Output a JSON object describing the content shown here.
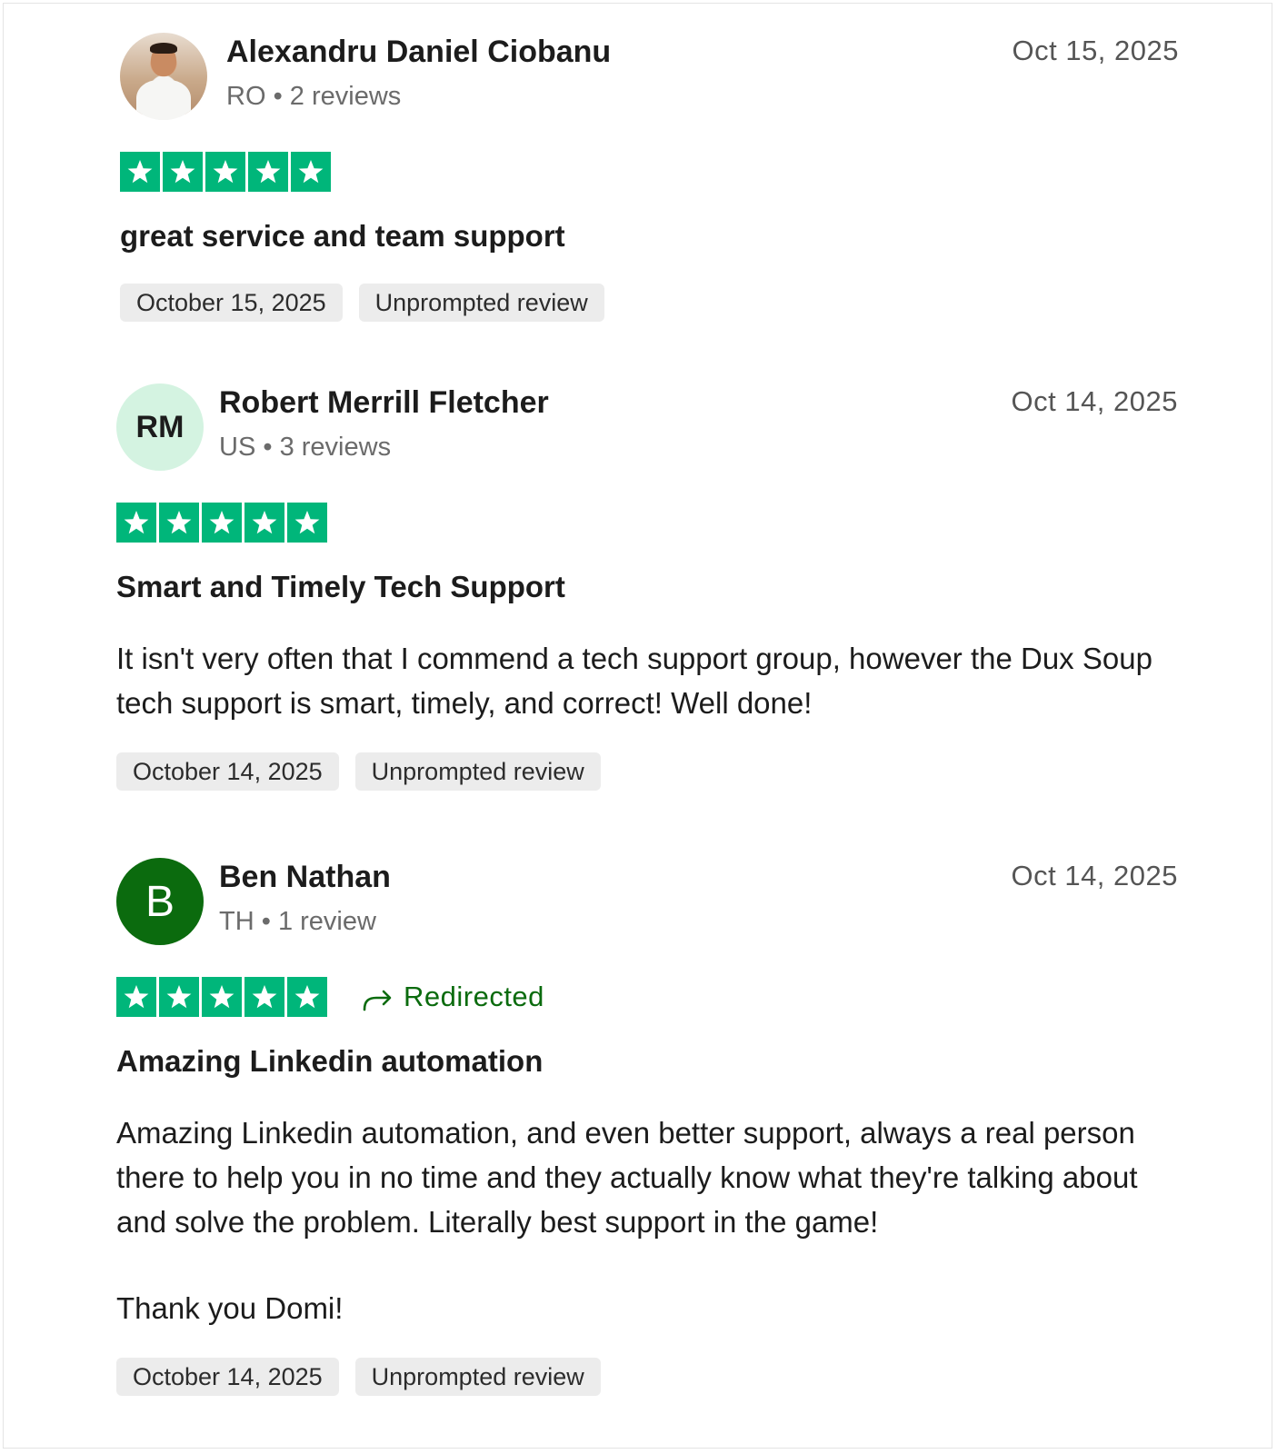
{
  "reviews": [
    {
      "name": "Alexandru Daniel Ciobanu",
      "country": "RO",
      "review_count": "2 reviews",
      "date_short": "Oct 15, 2025",
      "rating": 5,
      "avatar_type": "photo",
      "title": "great service and team support",
      "body": [],
      "date_long": "October 15, 2025",
      "tag": "Unprompted review"
    },
    {
      "name": "Robert Merrill Fletcher",
      "country": "US",
      "review_count": "3 reviews",
      "date_short": "Oct 14, 2025",
      "rating": 5,
      "avatar_type": "initials",
      "avatar_text": "RM",
      "avatar_color": "#d4f3e1",
      "title": "Smart and Timely Tech Support",
      "body": [
        "It isn't very often that I commend a tech support group, however the Dux Soup tech support is smart, timely, and correct! Well done!"
      ],
      "date_long": "October 14, 2025",
      "tag": "Unprompted review"
    },
    {
      "name": "Ben Nathan",
      "country": "TH",
      "review_count": "1 review",
      "date_short": "Oct 14, 2025",
      "rating": 5,
      "avatar_type": "letter",
      "avatar_text": "B",
      "avatar_color": "#0b6b0e",
      "redirected_label": "Redirected",
      "title": "Amazing Linkedin automation",
      "body": [
        "Amazing Linkedin automation, and even better support, always a real person there to help you in no time and they actually know what they're talking about and solve the problem. Literally best support in the game!",
        "Thank you Domi!"
      ],
      "date_long": "October 14, 2025",
      "tag": "Unprompted review"
    }
  ],
  "separator": "•",
  "colors": {
    "star_green": "#00b67a",
    "redirect_green": "#0b6b0e",
    "tag_bg": "#ececec"
  },
  "icons": {
    "star": "star-icon",
    "redirect": "redirect-arrow-icon"
  }
}
